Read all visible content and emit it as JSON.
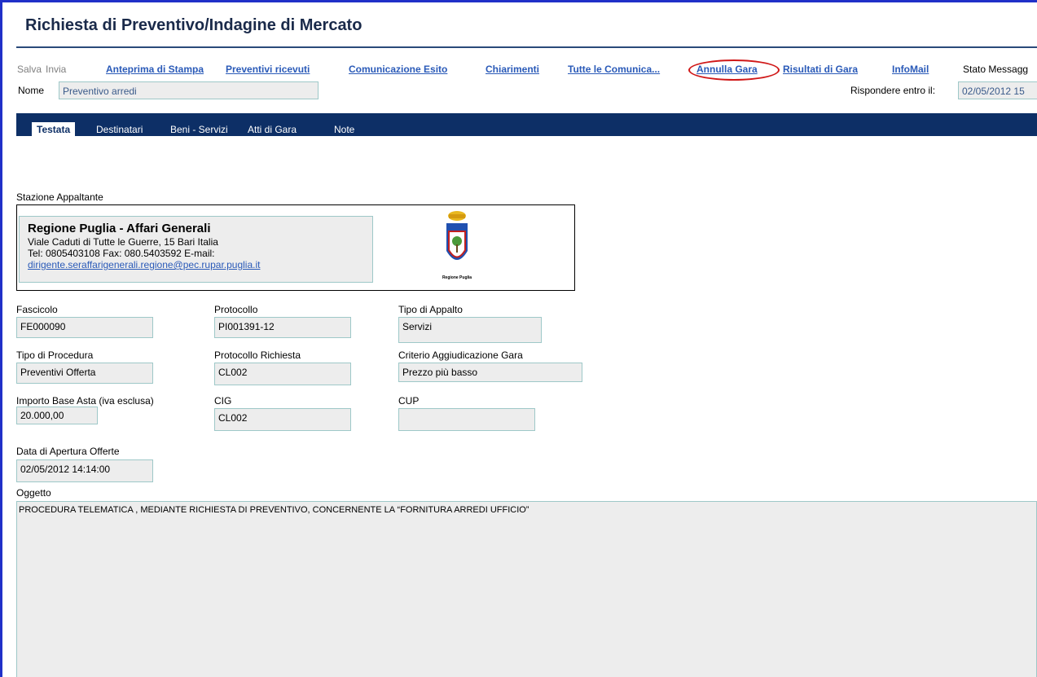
{
  "header": {
    "title": "Richiesta di Preventivo/Indagine di Mercato"
  },
  "toolbar": {
    "salva": "Salva",
    "invia": "Invia",
    "anteprima": "Anteprima di Stampa",
    "preventivi": "Preventivi ricevuti",
    "comunicazione_esito": "Comunicazione Esito",
    "chiarimenti": "Chiarimenti",
    "tutte_comunicazioni": "Tutte le Comunica...",
    "annulla_gara": "Annulla Gara",
    "risultati": "Risultati di Gara",
    "infomail": "InfoMail",
    "stato_messaggio": "Stato Messagg"
  },
  "nome": {
    "label": "Nome",
    "value": "Preventivo arredi"
  },
  "rispondere": {
    "label": "Rispondere entro il:",
    "value": "02/05/2012 15"
  },
  "tabs": [
    "Testata",
    "Destinatari",
    "Beni - Servizi",
    "Atti di Gara",
    "Note"
  ],
  "stazione": {
    "label": "Stazione Appaltante",
    "name": "Regione Puglia - Affari Generali",
    "address": "Viale Caduti di Tutte le Guerre, 15 Bari Italia",
    "contacts": "Tel: 0805403108 Fax: 080.5403592 E-mail:",
    "email": "dirigente.seraffarigenerali.regione@pec.rupar.puglia.it",
    "logo_caption": "Regione Puglia"
  },
  "fields": {
    "fascicolo": {
      "label": "Fascicolo",
      "value": "FE000090"
    },
    "protocollo": {
      "label": "Protocollo",
      "value": "PI001391-12"
    },
    "tipo_appalto": {
      "label": "Tipo di Appalto",
      "value": "Servizi"
    },
    "tipo_procedura": {
      "label": "Tipo di Procedura",
      "value": "Preventivi Offerta"
    },
    "protocollo_richiesta": {
      "label": "Protocollo Richiesta",
      "value": "CL002"
    },
    "criterio": {
      "label": "Criterio Aggiudicazione Gara",
      "value": "Prezzo più basso"
    },
    "importo": {
      "label": "Importo Base Asta (iva esclusa)",
      "value": "20.000,00"
    },
    "cig": {
      "label": "CIG",
      "value": "CL002"
    },
    "cup": {
      "label": "CUP",
      "value": ""
    },
    "data_apertura": {
      "label": "Data di Apertura Offerte",
      "value": "02/05/2012 14:14:00"
    }
  },
  "oggetto": {
    "label": "Oggetto",
    "value": "PROCEDURA TELEMATICA , MEDIANTE RICHIESTA DI PREVENTIVO, CONCERNENTE LA “FORNITURA ARREDI UFFICIO”"
  },
  "colors": {
    "accent_border": "#2030c8",
    "tabbar": "#0d2f66",
    "link": "#2a5ab8",
    "highlight_circle": "#d01818"
  }
}
